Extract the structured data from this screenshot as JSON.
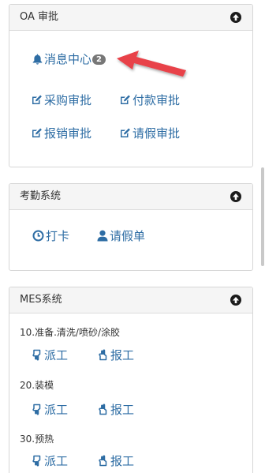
{
  "oa": {
    "title": "OA 审批",
    "message_center": {
      "label": "消息中心",
      "badge": "2"
    },
    "items": [
      {
        "label": "采购审批"
      },
      {
        "label": "付款审批"
      },
      {
        "label": "报销审批"
      },
      {
        "label": "请假审批"
      }
    ]
  },
  "attendance": {
    "title": "考勤系统",
    "items": [
      {
        "label": "打卡"
      },
      {
        "label": "请假单"
      }
    ]
  },
  "mes": {
    "title": "MES系统",
    "tasks": [
      {
        "name": "10.准备.清洗/喷砂/涂胶",
        "dispatch": "派工",
        "report": "报工"
      },
      {
        "name": "20.装模",
        "dispatch": "派工",
        "report": "报工"
      },
      {
        "name": "30.预热",
        "dispatch": "派工",
        "report": "报工"
      }
    ]
  },
  "colors": {
    "link": "#2e6da4",
    "panel_header": "#f5f5f5",
    "badge": "#777777",
    "annotation_arrow": "#e8424a"
  },
  "icons": {
    "message_center": "bell-icon",
    "approval": "edit-icon",
    "clock_in": "clock-icon",
    "leave_form": "user-icon",
    "dispatch": "hand-down-icon",
    "report": "hand-up-icon",
    "collapse": "circle-arrow-up-icon"
  }
}
